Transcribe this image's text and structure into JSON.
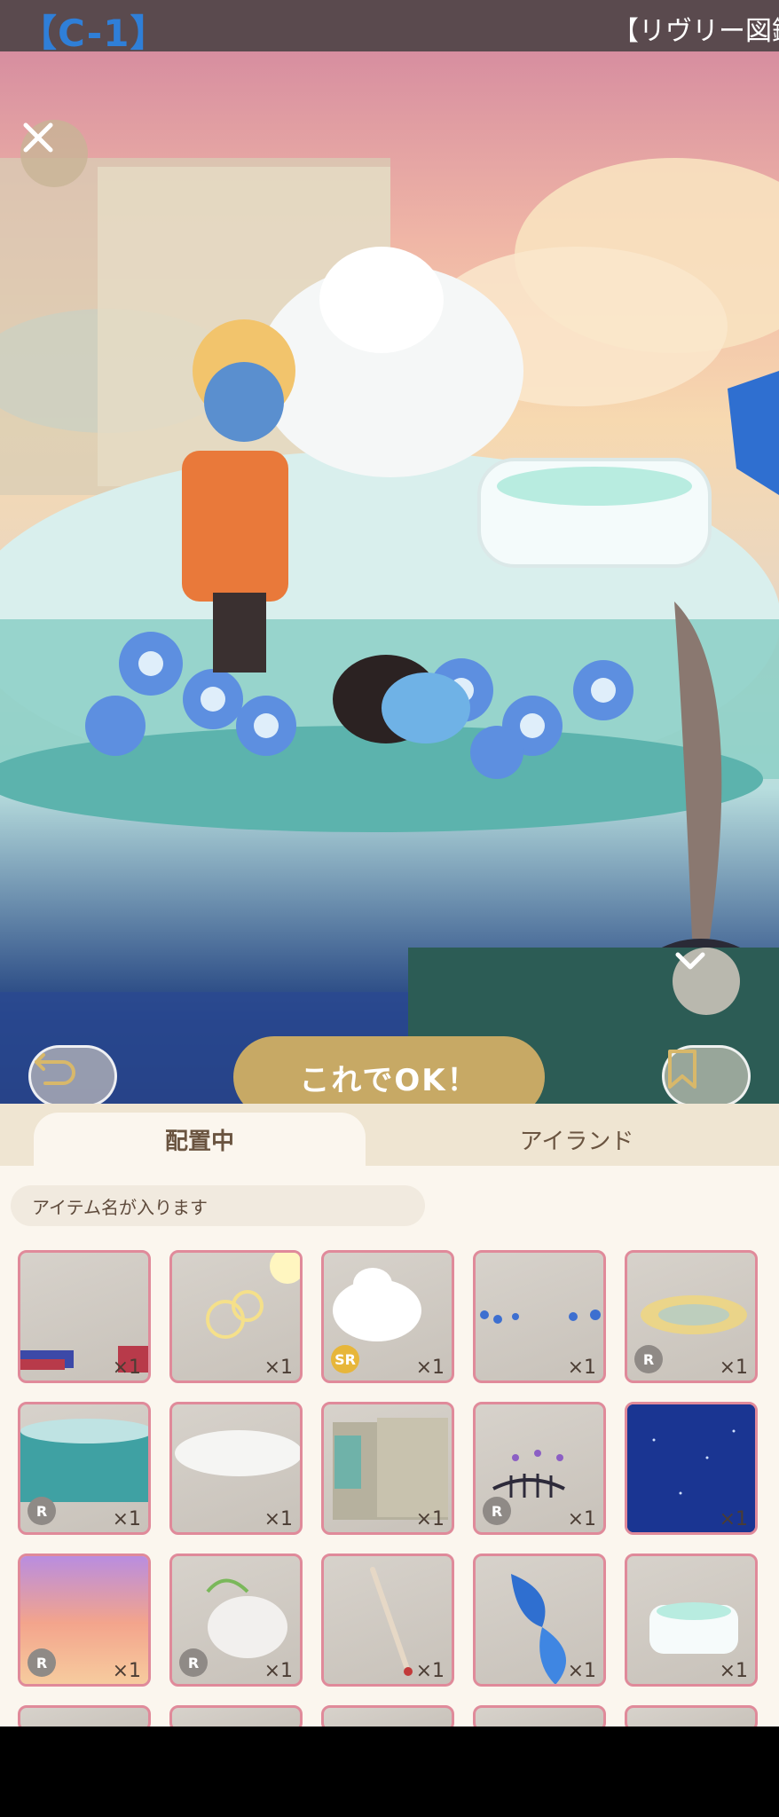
{
  "banner": {
    "code": "【C-1】",
    "title": "【リヴリー図鑑"
  },
  "scene": {
    "ok_label": "これでOK！"
  },
  "tabs": [
    {
      "label": "配置中",
      "active": true
    },
    {
      "label": "アイランド",
      "active": false
    }
  ],
  "item_name_placeholder": "アイテム名が入ります",
  "items": [
    {
      "qty": "×1",
      "badge": ""
    },
    {
      "qty": "×1",
      "badge": ""
    },
    {
      "qty": "×1",
      "badge": "SR"
    },
    {
      "qty": "×1",
      "badge": ""
    },
    {
      "qty": "×1",
      "badge": "R"
    },
    {
      "qty": "×1",
      "badge": "R"
    },
    {
      "qty": "×1",
      "badge": ""
    },
    {
      "qty": "×1",
      "badge": ""
    },
    {
      "qty": "×1",
      "badge": "R"
    },
    {
      "qty": "×1",
      "badge": ""
    },
    {
      "qty": "×1",
      "badge": "R"
    },
    {
      "qty": "×1",
      "badge": "R"
    },
    {
      "qty": "×1",
      "badge": ""
    },
    {
      "qty": "×1",
      "badge": ""
    },
    {
      "qty": "×1",
      "badge": ""
    }
  ],
  "colors": {
    "accent_gold": "#c7a965",
    "item_border": "#e08a9a",
    "tab_bg": "#efe5d2",
    "panel_bg": "#fbf6ee"
  }
}
